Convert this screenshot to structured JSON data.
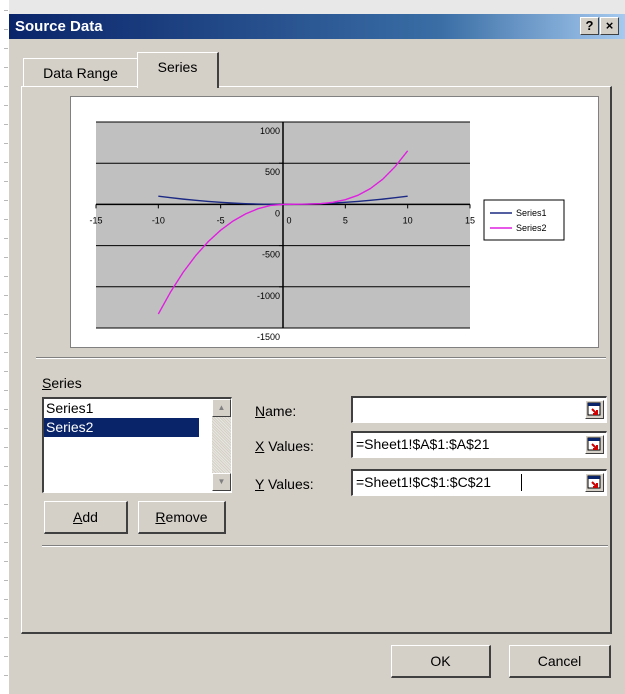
{
  "window": {
    "title": "Source Data",
    "help_label": "?",
    "close_label": "×"
  },
  "tabs": [
    {
      "label": "Data Range",
      "active": false
    },
    {
      "label": "Series",
      "active": true
    }
  ],
  "chart_data": {
    "type": "line",
    "title": "",
    "xlim": [
      -15,
      15
    ],
    "ylim": [
      -1500,
      1000
    ],
    "x_ticks": [
      "-15",
      "-10",
      "-5",
      "0",
      "5",
      "10",
      "15"
    ],
    "y_ticks": [
      "1000",
      "500",
      "0",
      "-500",
      "-1000",
      "-1500"
    ],
    "x": [
      -10,
      -9,
      -8,
      -7,
      -6,
      -5,
      -4,
      -3,
      -2,
      -1,
      0,
      1,
      2,
      3,
      4,
      5,
      6,
      7,
      8,
      9,
      10
    ],
    "series": [
      {
        "name": "Series1",
        "color": "#1c2a84",
        "values": [
          100,
          81,
          64,
          49,
          36,
          25,
          16,
          9,
          4,
          1,
          0,
          1,
          4,
          9,
          16,
          25,
          36,
          49,
          64,
          81,
          100
        ]
      },
      {
        "name": "Series2",
        "color": "#e020e0",
        "values": [
          -1330,
          -1058,
          -822,
          -621,
          -452,
          -313,
          -201,
          -115,
          -52,
          -13,
          0,
          3,
          4,
          9,
          25,
          57,
          110,
          191,
          306,
          459,
          650
        ]
      }
    ],
    "legend_position": "right",
    "plot_background": "#c0c0c0"
  },
  "series_section": {
    "label_prefix": "",
    "label_accel": "S",
    "label_rest": "eries",
    "items": [
      {
        "label": "Series1",
        "selected": false
      },
      {
        "label": "Series2",
        "selected": true
      }
    ],
    "add_accel": "A",
    "add_rest": "dd",
    "remove_accel": "R",
    "remove_rest": "emove"
  },
  "fields": {
    "name": {
      "accel": "N",
      "rest": "ame:",
      "value": ""
    },
    "x_values": {
      "accel": "X",
      "rest": " Values:",
      "value": "=Sheet1!$A$1:$A$21"
    },
    "y_values": {
      "accel": "Y",
      "rest": " Values:",
      "value": "=Sheet1!$C$1:$C$21"
    }
  },
  "footer": {
    "ok_label": "OK",
    "cancel_label": "Cancel"
  }
}
